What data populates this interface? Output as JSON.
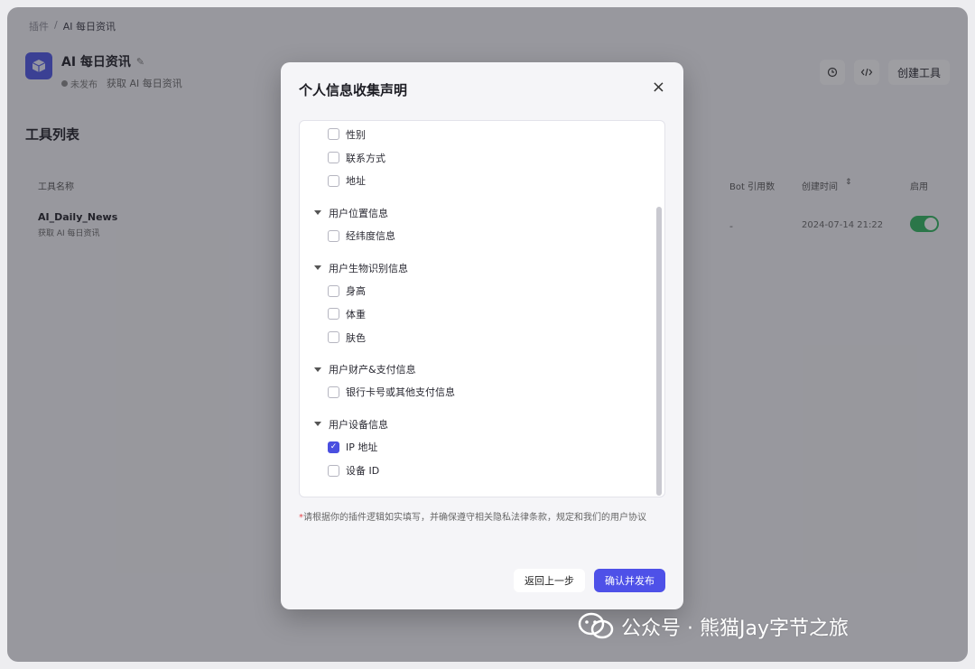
{
  "breadcrumb": {
    "root": "插件",
    "separator": "/",
    "current": "AI 每日资讯"
  },
  "plugin": {
    "title": "AI 每日资讯",
    "status": "未发布",
    "description": "获取 AI 每日资讯"
  },
  "toolbar": {
    "create_tool": "创建工具"
  },
  "tool_list": {
    "title": "工具列表",
    "headers": {
      "name": "工具名称",
      "bot_refs": "Bot 引用数",
      "created": "创建时间",
      "enabled": "启用"
    },
    "rows": [
      {
        "name": "AI_Daily_News",
        "desc": "获取 AI 每日资讯",
        "bot_refs": "-",
        "created": "2024-07-14 21:22",
        "enabled": true
      }
    ]
  },
  "modal": {
    "title": "个人信息收集声明",
    "close": "×",
    "items_top": [
      {
        "label": "性别",
        "checked": false
      },
      {
        "label": "联系方式",
        "checked": false
      },
      {
        "label": "地址",
        "checked": false
      }
    ],
    "categories": [
      {
        "label": "用户位置信息",
        "items": [
          {
            "label": "经纬度信息",
            "checked": false
          }
        ]
      },
      {
        "label": "用户生物识别信息",
        "items": [
          {
            "label": "身高",
            "checked": false
          },
          {
            "label": "体重",
            "checked": false
          },
          {
            "label": "肤色",
            "checked": false
          }
        ]
      },
      {
        "label": "用户财产&支付信息",
        "items": [
          {
            "label": "银行卡号或其他支付信息",
            "checked": false
          }
        ]
      },
      {
        "label": "用户设备信息",
        "items": [
          {
            "label": "IP 地址",
            "checked": true
          },
          {
            "label": "设备 ID",
            "checked": false
          }
        ]
      }
    ],
    "note_star": "*",
    "note": "请根据你的插件逻辑如实填写，并确保遵守相关隐私法律条款，规定和我们的用户协议",
    "back": "返回上一步",
    "confirm": "确认并发布"
  },
  "watermark": "公众号 · 熊猫Jay字节之旅",
  "colors": {
    "primary": "#4e51e8",
    "toggle_on": "#2eb75e",
    "danger": "#e5484d"
  }
}
